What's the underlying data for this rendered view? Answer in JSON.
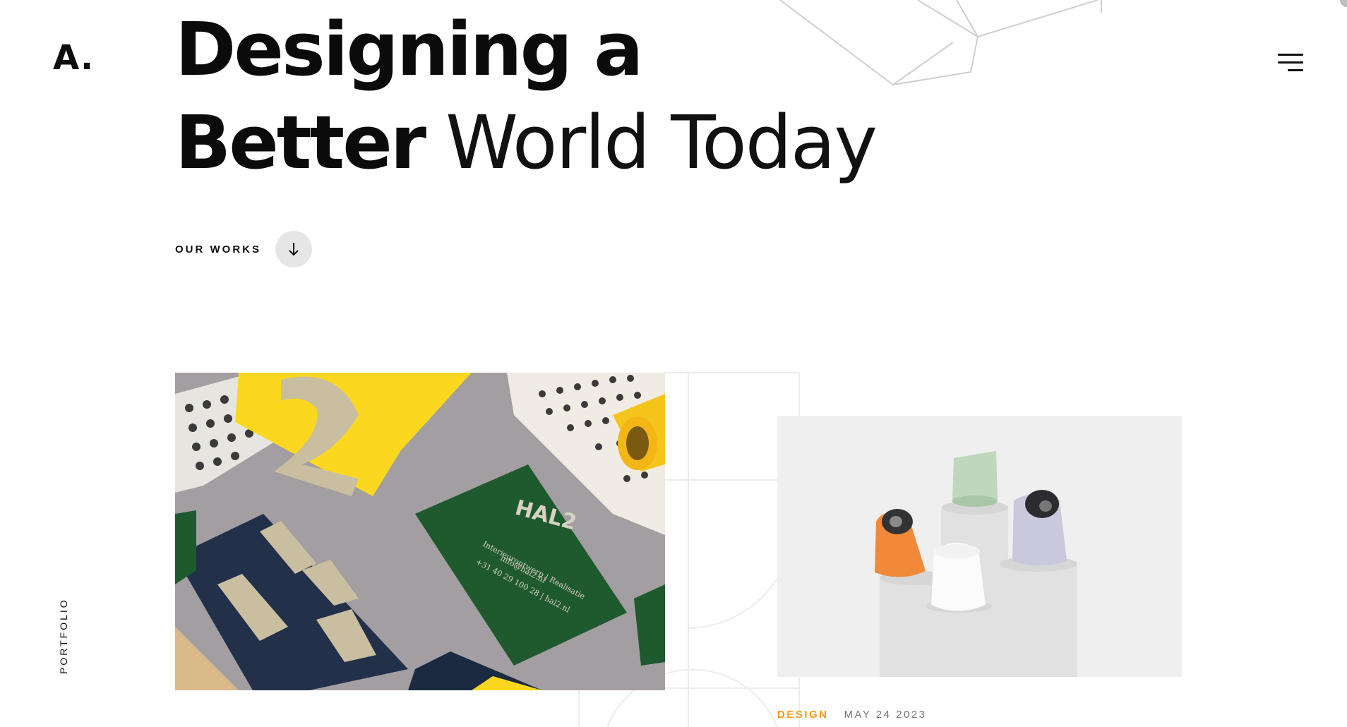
{
  "brand": {
    "logo_text": "A."
  },
  "hero": {
    "line1_bold": "Designing a",
    "line2_bold": "Better",
    "line2_light": "World Today"
  },
  "works_link": {
    "label": "OUR WORKS",
    "icon": "arrow-down-icon"
  },
  "side_label": "PORTFOLIO",
  "menu": {
    "icon": "hamburger-menu-icon"
  },
  "cards": [
    {
      "image_desc": "stationery-mockup",
      "image_text": {
        "brand": "HAL2",
        "line1": "Interieurontwerp | Realisatie",
        "line2": "info@hal2.nl",
        "line3": "+31 40 29 100 28 | hal2.nl"
      }
    },
    {
      "image_desc": "camera-devices-on-pedestals",
      "category": "DESIGN",
      "date": "MAY 24 2023"
    }
  ],
  "colors": {
    "accent": "#f29b16",
    "text": "#111111",
    "muted": "#777777",
    "button_bg": "#e6e6e6"
  }
}
